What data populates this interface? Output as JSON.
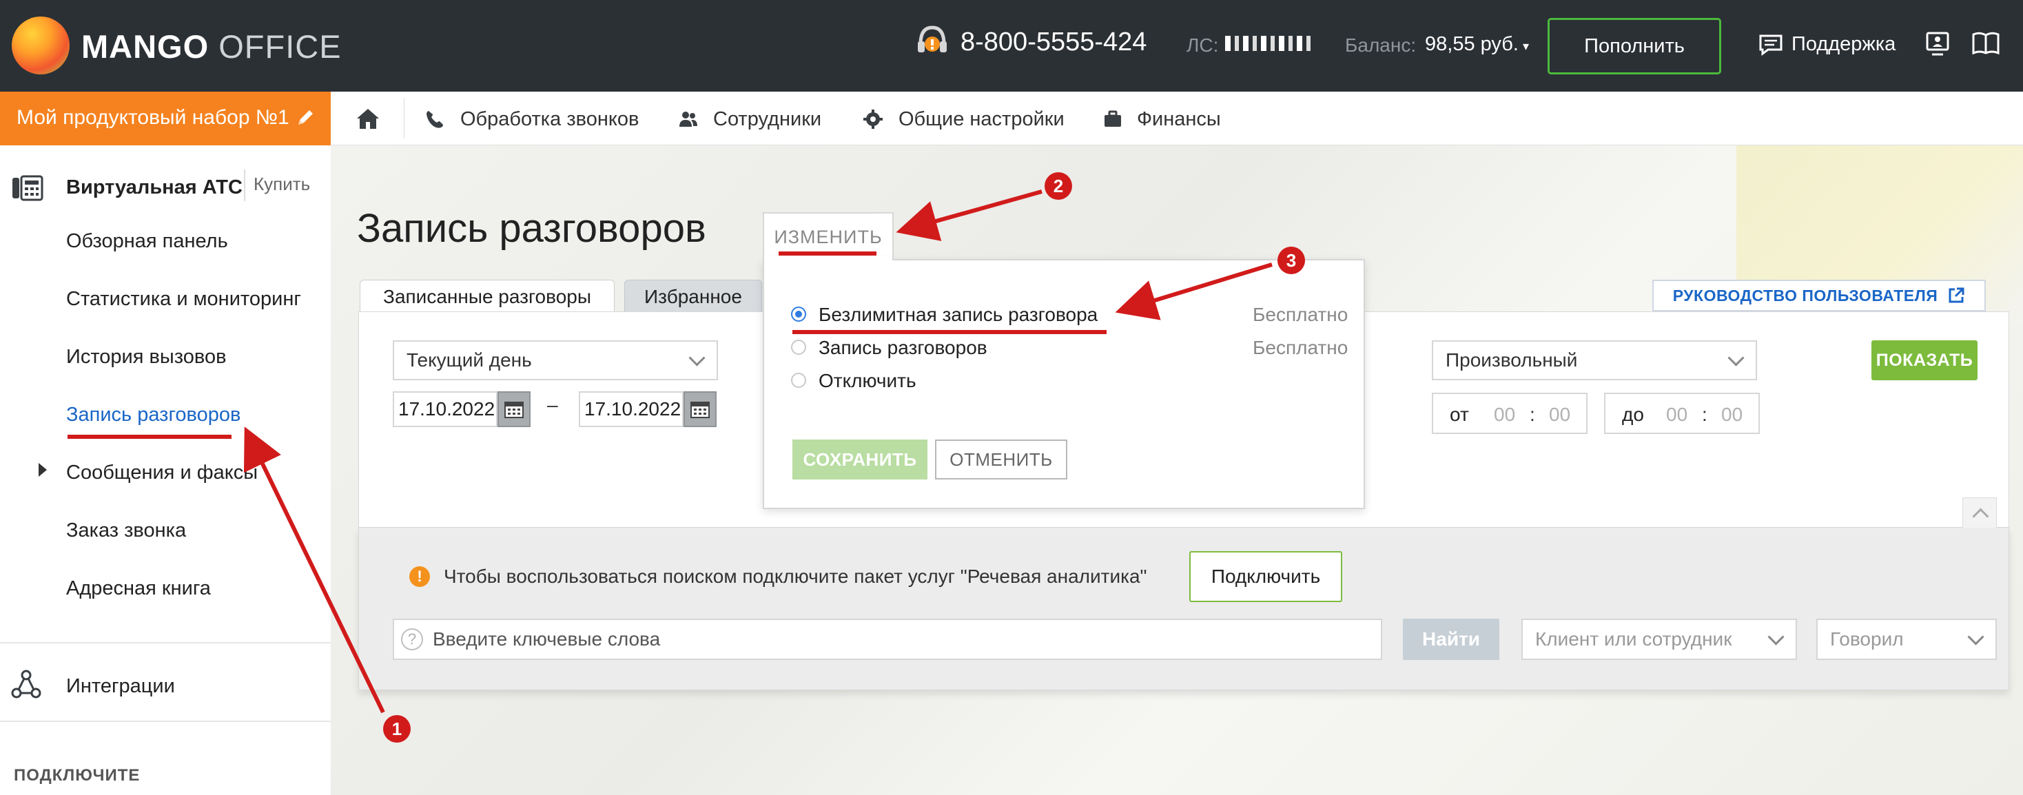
{
  "header": {
    "logo_bold": "MANGO",
    "logo_light": " OFFICE",
    "phone": "8-800-5555-424",
    "ls_label": "ЛС:",
    "balance_label": "Баланс:",
    "balance_value": "98,55 руб.",
    "topup_label": "Пополнить",
    "support_label": "Поддержка"
  },
  "product": {
    "label": "Мой продуктовый набор №1"
  },
  "nav": {
    "items": [
      {
        "label": "Обработка звонков",
        "icon": "phone-icon"
      },
      {
        "label": "Сотрудники",
        "icon": "users-icon"
      },
      {
        "label": "Общие настройки",
        "icon": "gear-icon"
      },
      {
        "label": "Финансы",
        "icon": "briefcase-icon"
      }
    ]
  },
  "sidebar": {
    "title": "Виртуальная АТС",
    "buy": "Купить",
    "items": [
      {
        "label": "Обзорная панель"
      },
      {
        "label": "Статистика и мониторинг"
      },
      {
        "label": "История вызовов"
      },
      {
        "label": "Запись разговоров",
        "active": true
      },
      {
        "label": "Сообщения и факсы"
      },
      {
        "label": "Заказ звонка"
      },
      {
        "label": "Адресная книга"
      }
    ],
    "integrations": "Интеграции",
    "connect_heading": "ПОДКЛЮЧИТЕ"
  },
  "page": {
    "title": "Запись разговоров",
    "edit_tab": "ИЗМЕНИТЬ",
    "tabs": [
      "Записанные разговоры",
      "Избранное"
    ],
    "guide": "РУКОВОДСТВО ПОЛЬЗОВАТЕЛЯ"
  },
  "filters": {
    "period": "Текущий день",
    "date_from": "17.10.2022",
    "date_sep": "–",
    "date_to": "17.10.2022",
    "time_mode": "Произвольный",
    "from_label": "от",
    "to_label": "до",
    "hh": "00",
    "mm": "00",
    "colon": ":",
    "show": "ПОКАЗАТЬ"
  },
  "search": {
    "info": "Чтобы воспользоваться поиском подключите пакет услуг \"Речевая аналитика\"",
    "info_icon": "!",
    "connect": "Подключить",
    "help": "?",
    "placeholder": "Введите ключевые слова",
    "find": "Найти",
    "client": "Клиент или сотрудник",
    "spoke": "Говорил"
  },
  "popup": {
    "options": [
      {
        "label": "Безлимитная запись разговора",
        "price": "Бесплатно",
        "selected": true
      },
      {
        "label": "Запись разговоров",
        "price": "Бесплатно",
        "selected": false
      },
      {
        "label": "Отключить",
        "price": "",
        "selected": false
      }
    ],
    "save": "СОХРАНИТЬ",
    "cancel": "ОТМЕНИТЬ"
  },
  "annotations": {
    "color": "#d11b1b",
    "badges": [
      "1",
      "2",
      "3"
    ]
  }
}
